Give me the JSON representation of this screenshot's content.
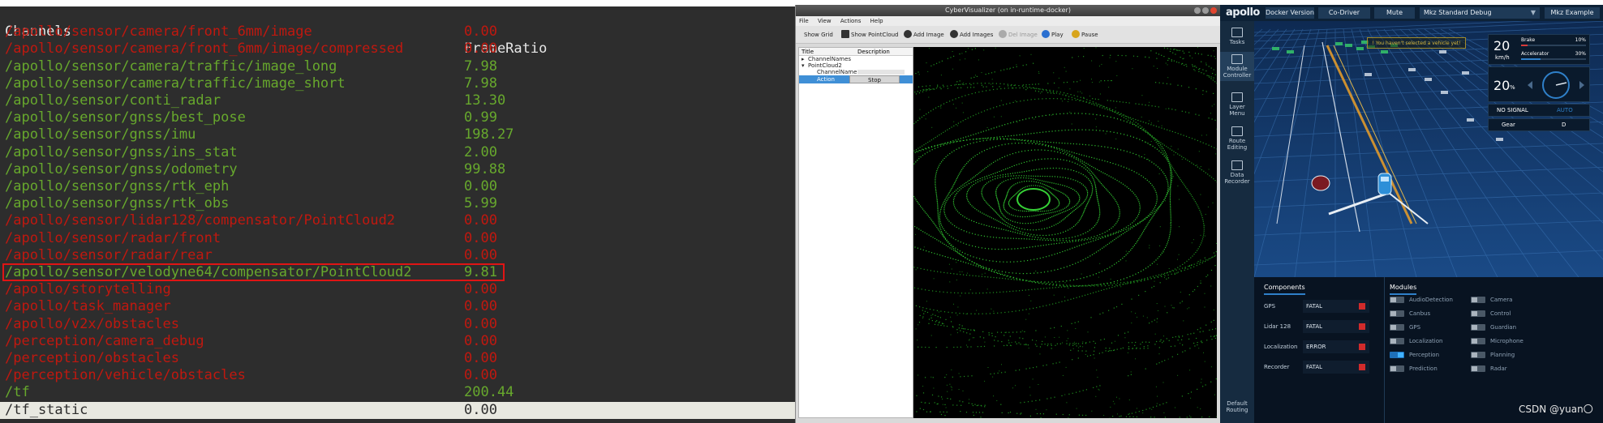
{
  "terminal": {
    "header": {
      "channel": "Channels",
      "frame_ratio": "FrameRatio"
    },
    "rows": [
      {
        "channel": "/apollo/sensor/camera/front_6mm/image",
        "ratio": "0.00",
        "status": "red"
      },
      {
        "channel": "/apollo/sensor/camera/front_6mm/image/compressed",
        "ratio": "0.00",
        "status": "red"
      },
      {
        "channel": "/apollo/sensor/camera/traffic/image_long",
        "ratio": "7.98",
        "status": "green"
      },
      {
        "channel": "/apollo/sensor/camera/traffic/image_short",
        "ratio": "7.98",
        "status": "green"
      },
      {
        "channel": "/apollo/sensor/conti_radar",
        "ratio": "13.30",
        "status": "green"
      },
      {
        "channel": "/apollo/sensor/gnss/best_pose",
        "ratio": "0.99",
        "status": "green"
      },
      {
        "channel": "/apollo/sensor/gnss/imu",
        "ratio": "198.27",
        "status": "green"
      },
      {
        "channel": "/apollo/sensor/gnss/ins_stat",
        "ratio": "2.00",
        "status": "green"
      },
      {
        "channel": "/apollo/sensor/gnss/odometry",
        "ratio": "99.88",
        "status": "green"
      },
      {
        "channel": "/apollo/sensor/gnss/rtk_eph",
        "ratio": "0.00",
        "status": "green"
      },
      {
        "channel": "/apollo/sensor/gnss/rtk_obs",
        "ratio": "5.99",
        "status": "green"
      },
      {
        "channel": "/apollo/sensor/lidar128/compensator/PointCloud2",
        "ratio": "0.00",
        "status": "red"
      },
      {
        "channel": "/apollo/sensor/radar/front",
        "ratio": "0.00",
        "status": "red"
      },
      {
        "channel": "/apollo/sensor/radar/rear",
        "ratio": "0.00",
        "status": "red"
      },
      {
        "channel": "/apollo/sensor/velodyne64/compensator/PointCloud2",
        "ratio": "9.81",
        "status": "green",
        "highlighted": true
      },
      {
        "channel": "/apollo/storytelling",
        "ratio": "0.00",
        "status": "red"
      },
      {
        "channel": "/apollo/task_manager",
        "ratio": "0.00",
        "status": "red"
      },
      {
        "channel": "/apollo/v2x/obstacles",
        "ratio": "0.00",
        "status": "red"
      },
      {
        "channel": "/perception/camera_debug",
        "ratio": "0.00",
        "status": "red"
      },
      {
        "channel": "/perception/obstacles",
        "ratio": "0.00",
        "status": "red"
      },
      {
        "channel": "/perception/vehicle/obstacles",
        "ratio": "0.00",
        "status": "red"
      },
      {
        "channel": "/tf",
        "ratio": "200.44",
        "status": "green"
      },
      {
        "channel": "/tf_static",
        "ratio": "0.00",
        "status": "selected"
      }
    ]
  },
  "visualizer": {
    "title": "CyberVisualizer (on in-runtime-docker)",
    "menu": [
      "File",
      "View",
      "Actions",
      "Help"
    ],
    "toolbar": {
      "show_grid": "Show Grid",
      "show_pointcloud": "Show PointCloud",
      "add_image": "Add Image",
      "add_images": "Add Images",
      "del_image": "Del Image",
      "play": "Play",
      "pause": "Pause"
    },
    "tree": {
      "col_title": "Title",
      "col_desc": "Description",
      "channel_names": "ChannelNames",
      "pointcloud": "PointCloud2",
      "channel_name_label": "ChannelName",
      "action_label": "Action",
      "stop_label": "Stop"
    }
  },
  "dreamview": {
    "logo": "apollo",
    "docker_version": "Docker Version",
    "co_driver": "Co-Driver",
    "mute": "Mute",
    "mode": "Mkz Standard Debug",
    "vehicle": "Mkz Example",
    "warning": "You haven't selected a vehicle yet!",
    "sidebar": {
      "tasks": "Tasks",
      "module_controller": "Module Controller",
      "layer_menu": "Layer Menu",
      "route_editing": "Route Editing",
      "data_recorder": "Data Recorder",
      "default_routing": "Default Routing"
    },
    "dashboard": {
      "speed": "20",
      "speed_unit": "km/h",
      "brake_label": "Brake",
      "brake_value": "10%",
      "accel_label": "Accelerator",
      "accel_value": "30%",
      "steer": "20",
      "steer_unit": "%",
      "signal": "NO SIGNAL",
      "auto": "AUTO",
      "gear_label": "Gear",
      "gear_value": "D"
    },
    "components": {
      "title": "Components",
      "items": [
        {
          "name": "GPS",
          "status": "FATAL"
        },
        {
          "name": "Lidar 128",
          "status": "FATAL"
        },
        {
          "name": "Localization",
          "status": "ERROR"
        },
        {
          "name": "Recorder",
          "status": "FATAL"
        }
      ]
    },
    "modules": {
      "title": "Modules",
      "left": [
        {
          "name": "AudioDetection",
          "on": false
        },
        {
          "name": "Canbus",
          "on": false
        },
        {
          "name": "GPS",
          "on": false
        },
        {
          "name": "Localization",
          "on": false
        },
        {
          "name": "Perception",
          "on": true
        },
        {
          "name": "Prediction",
          "on": false
        }
      ],
      "right": [
        {
          "name": "Camera",
          "on": false
        },
        {
          "name": "Control",
          "on": false
        },
        {
          "name": "Guardian",
          "on": false
        },
        {
          "name": "Microphone",
          "on": false
        },
        {
          "name": "Planning",
          "on": false
        },
        {
          "name": "Radar",
          "on": false
        }
      ]
    }
  },
  "watermark": "CSDN @yuan〇"
}
